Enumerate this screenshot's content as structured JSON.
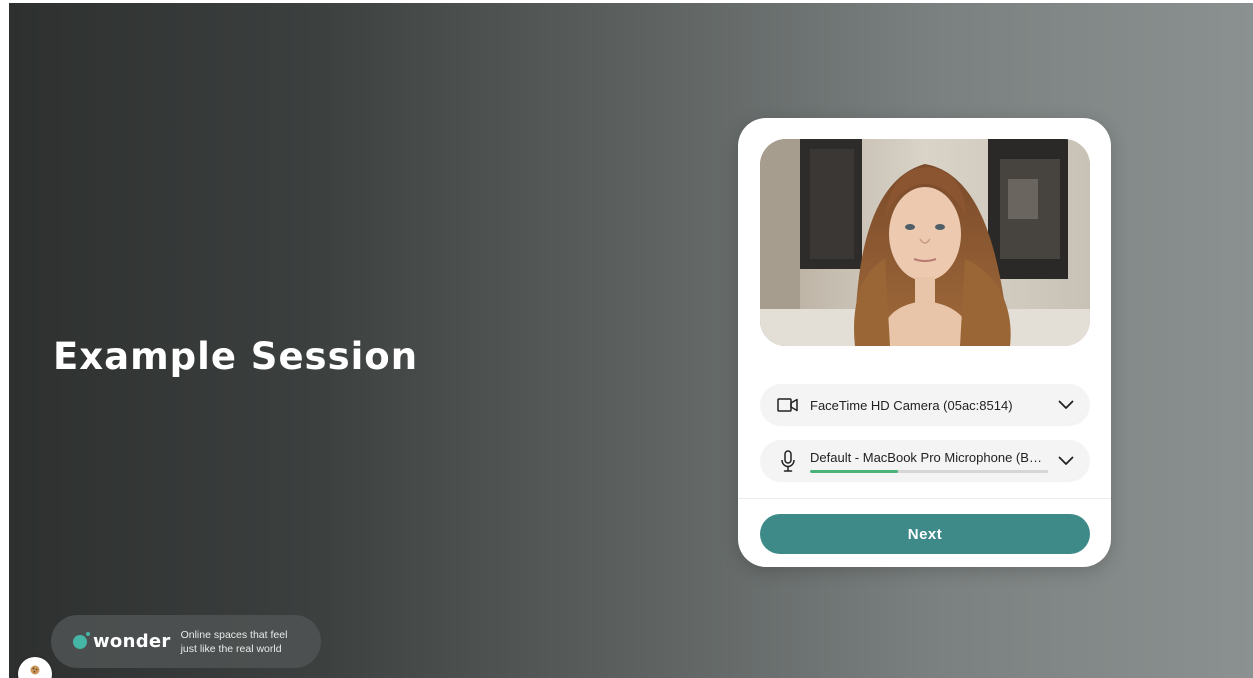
{
  "session": {
    "title": "Example Session"
  },
  "setup_card": {
    "camera_preview_alt": "",
    "camera_select": {
      "icon": "video-camera-icon",
      "label": "FaceTime HD Camera (05ac:8514)"
    },
    "microphone_select": {
      "icon": "microphone-icon",
      "label": "Default - MacBook Pro Microphone (Built-in)",
      "input_level": 0.37
    },
    "next_label": "Next"
  },
  "brand": {
    "name": "wonder",
    "tagline_line1": "Online spaces that feel",
    "tagline_line2": "just like the real world"
  },
  "cookie_settings": {
    "icon": "cookie-icon"
  },
  "colors": {
    "accent": "#3d8a88",
    "brand_dot": "#45b5a5",
    "level_fill": "#48b27a",
    "background_dark": "#2d302f",
    "background_light": "#8b9190"
  }
}
